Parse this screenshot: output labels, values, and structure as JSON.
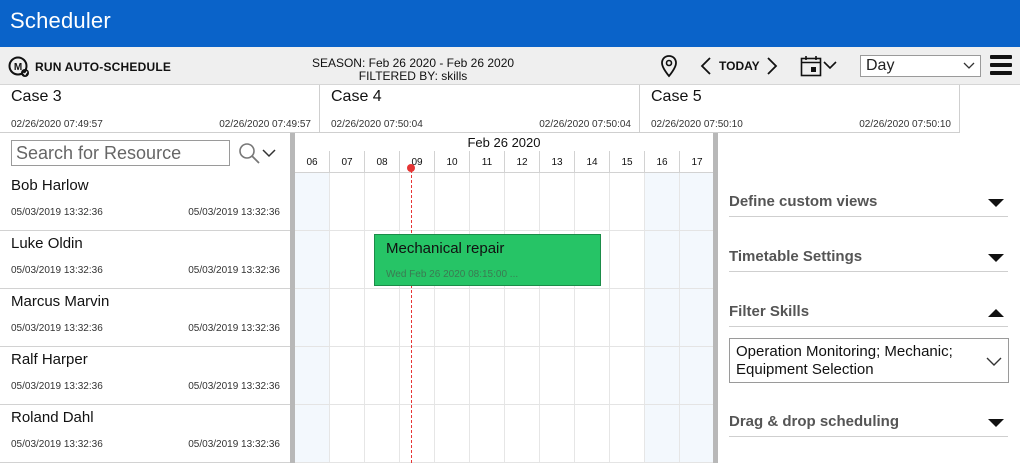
{
  "app": {
    "title": "Scheduler"
  },
  "toolbar": {
    "run_label": "RUN AUTO-SCHEDULE",
    "season_line": "SEASON: Feb 26 2020 - Feb 26 2020",
    "filter_line": "FILTERED BY: skills",
    "today_label": "TODAY",
    "view_value": "Day",
    "icons": [
      "m-logo-icon",
      "location-pin-icon",
      "chevron-left-icon",
      "chevron-right-icon",
      "calendar-icon",
      "chevron-down-icon",
      "hamburger-menu-icon"
    ]
  },
  "cases": [
    {
      "name": "Case 3",
      "start": "02/26/2020 07:49:57",
      "end": "02/26/2020 07:49:57"
    },
    {
      "name": "Case 4",
      "start": "02/26/2020 07:50:04",
      "end": "02/26/2020 07:50:04"
    },
    {
      "name": "Case 5",
      "start": "02/26/2020 07:50:10",
      "end": "02/26/2020 07:50:10"
    }
  ],
  "search": {
    "placeholder": "Search for Resource"
  },
  "resources": [
    {
      "name": "Bob Harlow",
      "start": "05/03/2019 13:32:36",
      "end": "05/03/2019 13:32:36"
    },
    {
      "name": "Luke Oldin",
      "start": "05/03/2019 13:32:36",
      "end": "05/03/2019 13:32:36"
    },
    {
      "name": "Marcus Marvin",
      "start": "05/03/2019 13:32:36",
      "end": "05/03/2019 13:32:36"
    },
    {
      "name": "Ralf Harper",
      "start": "05/03/2019 13:32:36",
      "end": "05/03/2019 13:32:36"
    },
    {
      "name": "Roland Dahl",
      "start": "05/03/2019 13:32:36",
      "end": "05/03/2019 13:32:36"
    }
  ],
  "timeline": {
    "date": "Feb 26 2020",
    "hours": [
      "06",
      "07",
      "08",
      "09",
      "10",
      "11",
      "12",
      "13",
      "14",
      "15",
      "16",
      "17"
    ]
  },
  "event": {
    "title": "Mechanical repair",
    "subtitle": "Wed Feb 26 2020 08:15:00 ..."
  },
  "panel": {
    "sections": [
      {
        "label": "Define custom views",
        "expanded": false
      },
      {
        "label": "Timetable Settings",
        "expanded": false
      },
      {
        "label": "Filter Skills",
        "expanded": true
      },
      {
        "label": "Drag & drop scheduling",
        "expanded": false
      }
    ],
    "skills_value": "Operation Monitoring; Mechanic; Equipment Selection"
  },
  "colors": {
    "titlebar": "#0a63c9",
    "event": "#26c466",
    "now_line": "#e63535"
  }
}
